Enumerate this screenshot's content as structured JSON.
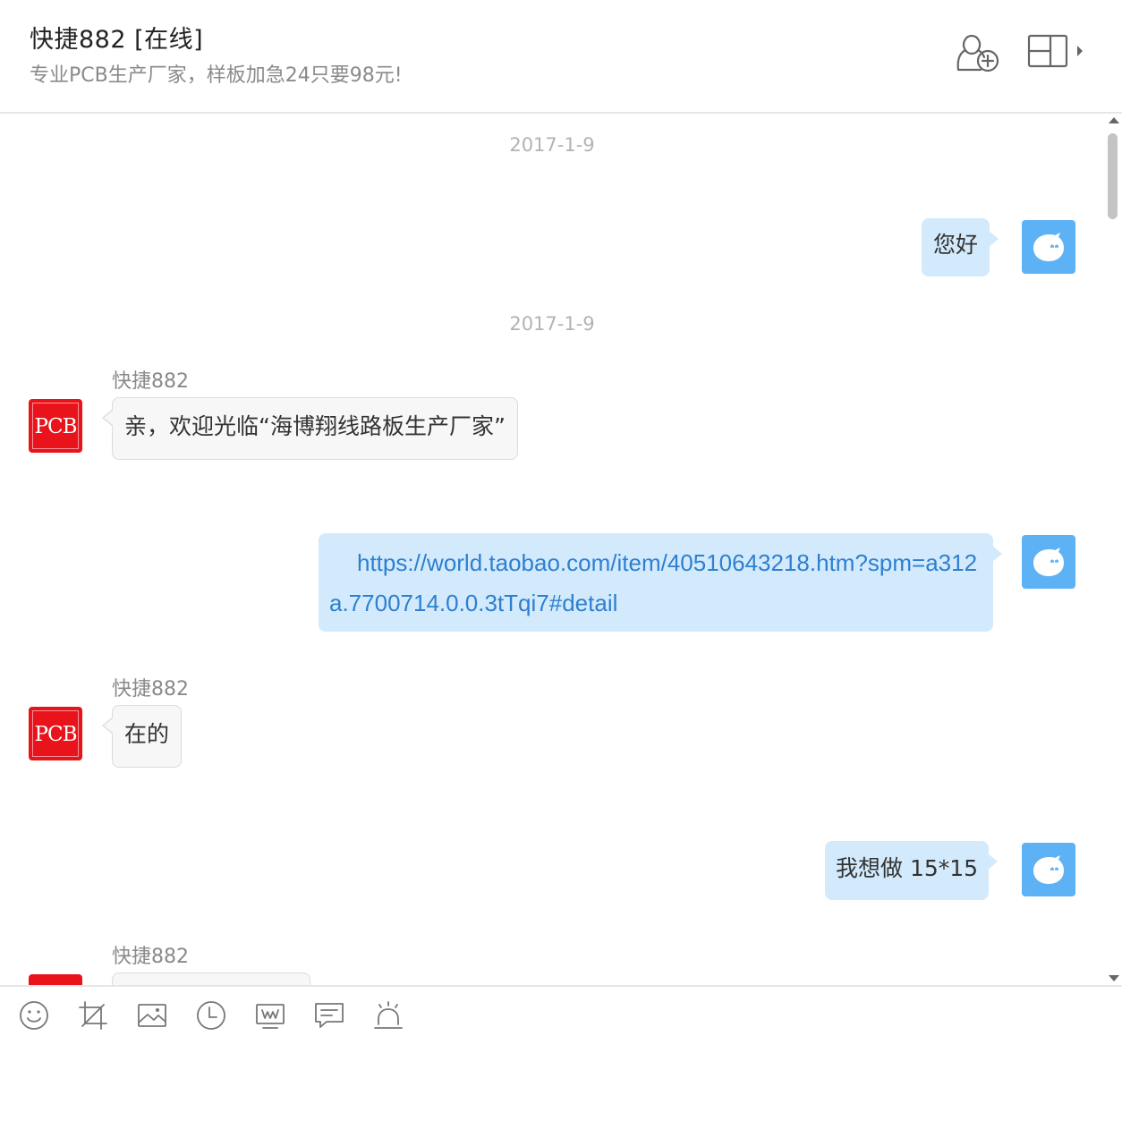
{
  "header": {
    "contact_name": "快捷882 [在线]",
    "signature": "专业PCB生产厂家，样板加急24只要98元!"
  },
  "avatars": {
    "pcb_label": "PCB"
  },
  "messages": [
    {
      "type": "timestamp",
      "text": "2017-1-9"
    },
    {
      "type": "sent",
      "text": "您好"
    },
    {
      "type": "timestamp",
      "text": "2017-1-9"
    },
    {
      "type": "received",
      "sender": "快捷882",
      "text": "亲，欢迎光临“海博翔线路板生产厂家”"
    },
    {
      "type": "sent",
      "text": "https://world.taobao.com/item/40510643218.htm?spm=a312a.7700714.0.0.3tTqi7#detail",
      "is_link": true
    },
    {
      "type": "received",
      "sender": "快捷882",
      "text": "在的"
    },
    {
      "type": "sent",
      "text": "我想做 15*15"
    },
    {
      "type": "received",
      "sender": "快捷882",
      "text": ""
    }
  ],
  "toolbar": {
    "items": [
      "emoji-icon",
      "screenshot-crop-icon",
      "image-icon",
      "history-clock-icon",
      "remote-screen-icon",
      "quick-reply-icon",
      "alert-bell-icon"
    ]
  },
  "colors": {
    "sent_bubble": "#d3eafd",
    "received_bubble": "#f7f7f7",
    "my_avatar": "#5db2f5",
    "pcb_avatar": "#e8131b",
    "link": "#2e7fcf"
  }
}
